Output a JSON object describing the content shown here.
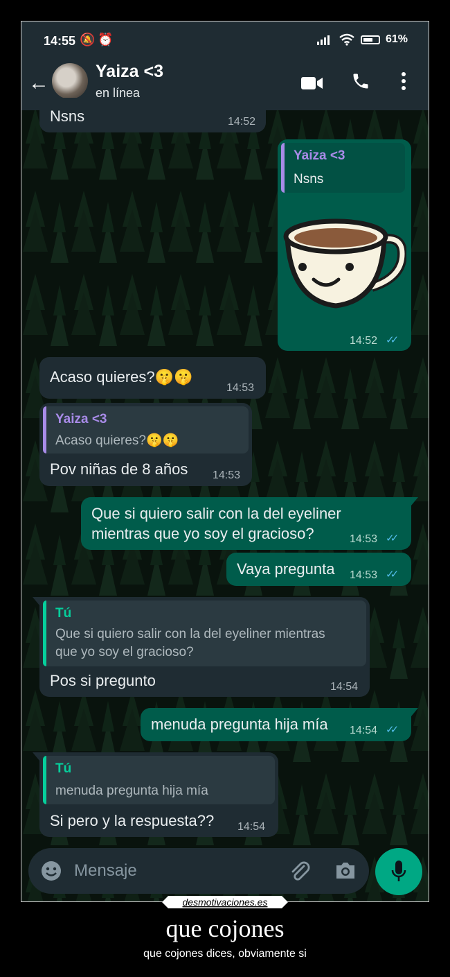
{
  "status_bar": {
    "time": "14:55",
    "battery": "61%"
  },
  "header": {
    "contact_name": "Yaiza <3",
    "contact_status": "en línea"
  },
  "messages": [
    {
      "text": "Nsns",
      "time": "14:52"
    },
    {
      "quote_author": "Yaiza <3",
      "quote_text": "Nsns",
      "time": "14:52"
    },
    {
      "text": "Acaso quieres?🤫🤫",
      "time": "14:53"
    },
    {
      "quote_author": "Yaiza <3",
      "quote_text": "Acaso quieres?🤫🤫",
      "text": "Pov niñas de 8 años",
      "time": "14:53"
    },
    {
      "text_line1": "Que si quiero salir con la del eyeliner",
      "text_line2": "mientras que yo soy el gracioso?",
      "time": "14:53"
    },
    {
      "text": "Vaya pregunta",
      "time": "14:53"
    },
    {
      "quote_author": "Tú",
      "quote_line1": "Que si quiero salir con la del eyeliner mientras",
      "quote_line2": "que yo soy el gracioso?",
      "text": "Pos si pregunto",
      "time": "14:54"
    },
    {
      "text": "menuda pregunta hija mía",
      "time": "14:54"
    },
    {
      "quote_author": "Tú",
      "quote_text": "menuda pregunta hija mía",
      "text": "Si pero y la respuesta??",
      "time": "14:54"
    }
  ],
  "composer": {
    "placeholder": "Mensaje"
  },
  "watermark": "desmotivaciones.es",
  "caption": {
    "title": "que cojones",
    "subtitle": "que cojones dices, obviamente si"
  },
  "colors": {
    "incoming_bubble": "#1f2c33",
    "outgoing_bubble": "#005c4b",
    "mic_button": "#00a884",
    "quote_name_purple": "#a88be8",
    "quote_name_green": "#06cf9c",
    "read_ticks": "#53bdeb"
  },
  "icons": [
    "back-arrow-icon",
    "video-call-icon",
    "phone-icon",
    "more-vert-icon",
    "emoji-icon",
    "attach-icon",
    "camera-icon",
    "mic-icon",
    "read-ticks-icon",
    "coffee-sticker",
    "signal-icon",
    "wifi-icon",
    "battery-icon",
    "mute-icon",
    "alarm-icon"
  ]
}
